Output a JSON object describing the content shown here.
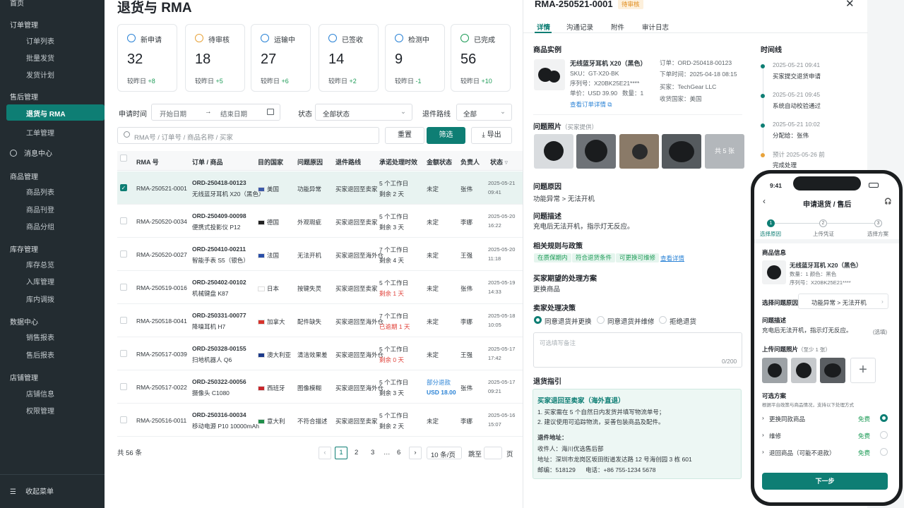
{
  "sidebar": {
    "home": "首页",
    "sections": [
      {
        "label": "订单管理",
        "items": [
          "订单列表",
          "批量发货",
          "发货计划"
        ]
      },
      {
        "label": "售后管理",
        "items": [
          "退货与 RMA",
          "工单管理"
        ]
      },
      {
        "label": "消息中心",
        "items": []
      },
      {
        "label": "商品管理",
        "items": [
          "商品列表",
          "商品刊登",
          "商品分组"
        ]
      },
      {
        "label": "库存管理",
        "items": [
          "库存总览",
          "入库管理",
          "库内调拨"
        ]
      },
      {
        "label": "数据中心",
        "items": [
          "销售报表",
          "售后报表"
        ]
      },
      {
        "label": "店铺管理",
        "items": [
          "店铺信息",
          "权限管理"
        ]
      }
    ],
    "collapse": "收起菜单"
  },
  "main": {
    "title": "退货与 RMA",
    "stats": [
      {
        "label": "新申请",
        "value": "32",
        "cmp_label": "较昨日",
        "cmp": "+8",
        "color": "#2b83d6"
      },
      {
        "label": "待审核",
        "value": "18",
        "cmp_label": "较昨日",
        "cmp": "+5",
        "color": "#e8a33a"
      },
      {
        "label": "运输中",
        "value": "27",
        "cmp_label": "较昨日",
        "cmp": "+6",
        "color": "#2b83d6"
      },
      {
        "label": "已签收",
        "value": "14",
        "cmp_label": "较昨日",
        "cmp": "+2",
        "color": "#2b83d6"
      },
      {
        "label": "检测中",
        "value": "9",
        "cmp_label": "较昨日",
        "cmp": "-1",
        "color": "#2b83d6"
      },
      {
        "label": "已完成",
        "value": "56",
        "cmp_label": "较昨日",
        "cmp": "+10",
        "color": "#1f9c58"
      }
    ],
    "filters": {
      "date_label": "申请时间",
      "start_placeholder": "开始日期",
      "arrow": "→",
      "end_placeholder": "结束日期",
      "status_label": "状态",
      "status_value": "全部状态",
      "route_label": "退件路线",
      "route_value": "全部",
      "search_placeholder": "RMA号 / 订单号 / 商品名称 / 买家",
      "reset": "重置",
      "filter": "筛选",
      "export": "导出"
    },
    "table": {
      "headers": [
        "RMA 号",
        "订单 / 商品",
        "目的国家",
        "问题原因",
        "退件路线",
        "承诺处理时效",
        "金额状态",
        "负责人",
        "状态"
      ],
      "rows": [
        {
          "rma": "RMA-250521-0001",
          "order": "ORD-250418-00123",
          "product": "无线蓝牙耳机 X20（黑色）",
          "country": "美国",
          "reason": "功能异常",
          "route": "买家退回至卖家",
          "sla": "5 个工作日",
          "remain": "剩余 2 天",
          "remain_red": false,
          "amount": "未定",
          "amount2": "",
          "owner": "张伟",
          "date": "2025-05-21",
          "time": "09:41",
          "selected": true
        },
        {
          "rma": "RMA-250520-0034",
          "order": "ORD-250409-00098",
          "product": "便携式投影仪 P12",
          "country": "德国",
          "reason": "外观瑕疵",
          "route": "买家退回至卖家",
          "sla": "5 个工作日",
          "remain": "剩余 3 天",
          "remain_red": false,
          "amount": "未定",
          "amount2": "",
          "owner": "李娜",
          "date": "2025-05-20",
          "time": "16:22",
          "selected": false
        },
        {
          "rma": "RMA-250520-0027",
          "order": "ORD-250410-00211",
          "product": "智能手表 S5（银色）",
          "country": "法国",
          "reason": "无法开机",
          "route": "买家退回至海外仓",
          "sla": "7 个工作日",
          "remain": "剩余 4 天",
          "remain_red": false,
          "amount": "未定",
          "amount2": "",
          "owner": "王强",
          "date": "2025-05-20",
          "time": "11:18",
          "selected": false
        },
        {
          "rma": "RMA-250519-0016",
          "order": "ORD-250402-00102",
          "product": "机械键盘 K87",
          "country": "日本",
          "reason": "按键失灵",
          "route": "买家退回至卖家",
          "sla": "5 个工作日",
          "remain": "剩余 1 天",
          "remain_red": true,
          "amount": "未定",
          "amount2": "",
          "owner": "张伟",
          "date": "2025-05-19",
          "time": "14:33",
          "selected": false
        },
        {
          "rma": "RMA-250518-0041",
          "order": "ORD-250331-00077",
          "product": "降噪耳机 H7",
          "country": "加拿大",
          "reason": "配件缺失",
          "route": "买家退回至海外仓",
          "sla": "7 个工作日",
          "remain": "已逾期 1 天",
          "remain_red": true,
          "amount": "未定",
          "amount2": "",
          "owner": "李娜",
          "date": "2025-05-18",
          "time": "10:05",
          "selected": false
        },
        {
          "rma": "RMA-250517-0039",
          "order": "ORD-250328-00155",
          "product": "扫地机器人 Q6",
          "country": "澳大利亚",
          "reason": "清洁效果差",
          "route": "买家退回至海外仓",
          "sla": "5 个工作日",
          "remain": "剩余 0 天",
          "remain_red": true,
          "amount": "未定",
          "amount2": "",
          "owner": "王强",
          "date": "2025-05-17",
          "time": "17:42",
          "selected": false
        },
        {
          "rma": "RMA-250517-0022",
          "order": "ORD-250322-00056",
          "product": "摄像头 C1080",
          "country": "西班牙",
          "reason": "图像模糊",
          "route": "买家退回至海外仓",
          "sla": "5 个工作日",
          "remain": "剩余 3 天",
          "remain_red": false,
          "amount": "部分退款",
          "amount2": "USD 18.00",
          "owner": "张伟",
          "date": "2025-05-17",
          "time": "09:21",
          "selected": false
        },
        {
          "rma": "RMA-250516-0011",
          "order": "ORD-250316-00034",
          "product": "移动电源 P10 10000mAh",
          "country": "意大利",
          "reason": "不符合描述",
          "route": "买家退回至卖家",
          "sla": "5 个工作日",
          "remain": "剩余 2 天",
          "remain_red": false,
          "amount": "未定",
          "amount2": "",
          "owner": "李娜",
          "date": "2025-05-16",
          "time": "15:07",
          "selected": false
        }
      ]
    },
    "pager": {
      "total": "共 56 条",
      "pages": [
        "1",
        "2",
        "3",
        "…",
        "6"
      ],
      "size": "10 条/页",
      "jump": "跳至",
      "page_unit": "页"
    }
  },
  "detail": {
    "rma": "RMA-250521-0001",
    "status": "待审核",
    "tabs": [
      "详情",
      "沟通记录",
      "附件",
      "审计日志"
    ],
    "product_section": "商品实例",
    "product_name": "无线蓝牙耳机 X20（黑色）",
    "sku": "SKU：GT-X20-BK",
    "serial": "序列号：X20BK25E21****",
    "price": "单价：USD 39.90",
    "qty": "数量：1",
    "view_order": "查看订单详情",
    "order_no": "订单：ORD-250418-00123",
    "order_time": "下单时间：2025-04-18 08:15",
    "buyer": "买家：TechGear LLC",
    "ship_country": "收货国家：美国",
    "photos_label": "问题照片",
    "photos_sub": "（买家提供）",
    "photos_more": "共 5 张",
    "reason_label": "问题原因",
    "reason": "功能异常 > 无法开机",
    "desc_label": "问题描述",
    "desc": "充电后无法开机，指示灯无反应。",
    "policy_label": "相关规则与政策",
    "policy_tags": [
      "在质保期内",
      "符合退货条件",
      "可更换可维修"
    ],
    "policy_link": "查看详情",
    "expect_label": "买家期望的处理方案",
    "expect": "更换商品",
    "decision_label": "卖家处理决策",
    "decisions": [
      "同意退货并更换",
      "同意退货并维修",
      "拒绝退货"
    ],
    "note_placeholder": "可选填写备注",
    "note_count": "0/200",
    "guide_label": "退货指引",
    "guide_title": "买家退回至卖家（海外直退）",
    "guide_lines": [
      "1. 买家需在 5 个自然日内发货并填写物流单号；",
      "2. 建议使用可追踪物流，妥善包装商品及配件。"
    ],
    "addr_label": "退件地址：",
    "recv": "收件人：海川优选售后部",
    "addr": "地址：深圳市龙岗区坂田街道发达路 12 号海创园 3 栋 601",
    "zip": "邮编：518129",
    "tel": "电话：+86 755-1234 5678",
    "timeline_label": "时间线",
    "timeline": [
      {
        "time": "2025-05-21 09:41",
        "text": "买家提交退货申请"
      },
      {
        "time": "2025-05-21 09:45",
        "text": "系统自动校验通过"
      },
      {
        "time": "2025-05-21 10:02",
        "text": "分配给：张伟"
      },
      {
        "time": "预计 2025-05-26 前",
        "text": "完成处理"
      }
    ]
  },
  "phone": {
    "clock": "9:41",
    "title": "申请退货 / 售后",
    "steps": [
      "选择原因",
      "上传凭证",
      "选择方案"
    ],
    "info_label": "商品信息",
    "product": "无线蓝牙耳机 X20（黑色）",
    "spec": "数量：1    颜色：黑色",
    "serial": "序列号：X20BK25E21****",
    "reason_label": "选择问题原因",
    "reason_value": "功能异常 > 无法开机",
    "desc_label": "问题描述",
    "desc": "充电后无法开机，指示灯无反应。",
    "desc_opt": "(选填)",
    "upload_label": "上传问题照片",
    "upload_sub": "（至少 1 张）",
    "plans_label": "可选方案",
    "plans_sub": "根据平台政策与商品情况，支持以下处理方式",
    "plans": [
      {
        "name": "更换同款商品",
        "fee": "免费",
        "selected": true
      },
      {
        "name": "维修",
        "fee": "免费",
        "selected": false
      },
      {
        "name": "退回商品（可能不退款）",
        "fee": "免费",
        "selected": false
      }
    ],
    "next": "下一步"
  }
}
